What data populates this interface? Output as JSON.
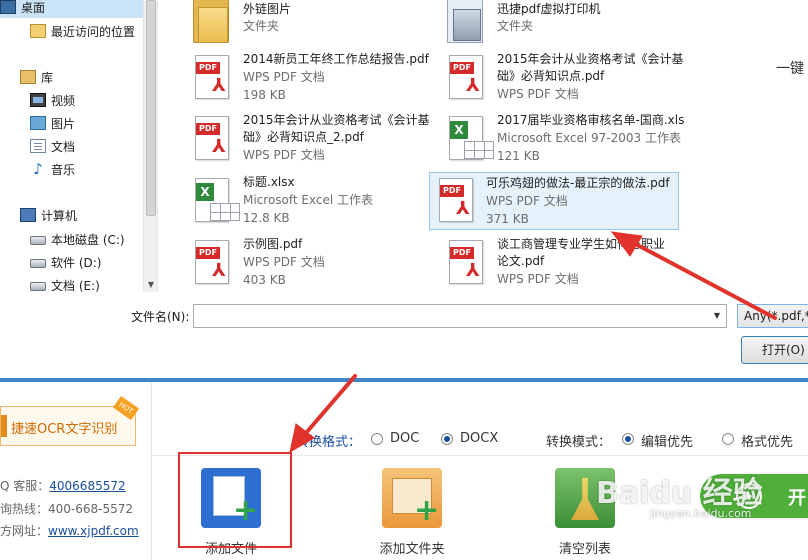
{
  "dialog": {
    "nav": {
      "items": [
        {
          "label": "桌面",
          "icon": "desktop-icon"
        },
        {
          "label": "最近访问的位置",
          "icon": "recent-places-icon"
        },
        {
          "label": "库",
          "icon": "library-icon"
        },
        {
          "label": "视频",
          "icon": "video-library-icon"
        },
        {
          "label": "图片",
          "icon": "picture-library-icon"
        },
        {
          "label": "文档",
          "icon": "document-library-icon"
        },
        {
          "label": "音乐",
          "icon": "music-library-icon"
        },
        {
          "label": "计算机",
          "icon": "computer-icon"
        },
        {
          "label": "本地磁盘 (C:)",
          "icon": "drive-icon"
        },
        {
          "label": "软件 (D:)",
          "icon": "drive-icon"
        },
        {
          "label": "文档 (E:)",
          "icon": "drive-icon"
        }
      ]
    },
    "files": [
      {
        "name": "外链图片",
        "type": "文件夹",
        "size": "",
        "icon": "folder-icon"
      },
      {
        "name": "迅捷pdf虚拟打印机",
        "type": "文件夹",
        "size": "",
        "icon": "folder-icon"
      },
      {
        "name": "2014新员工年终工作总结报告.pdf",
        "name2": "",
        "type": "WPS PDF 文档",
        "size": "198 KB",
        "icon": "pdf-file-icon"
      },
      {
        "name": "2015年会计从业资格考试《会计基",
        "name2": "础》必背知识点.pdf",
        "type": "WPS PDF 文档",
        "size": "",
        "icon": "pdf-file-icon"
      },
      {
        "name": "2015年会计从业资格考试《会计基",
        "name2": "础》必背知识点_2.pdf",
        "type": "WPS PDF 文档",
        "size": "",
        "icon": "pdf-file-icon"
      },
      {
        "name": "2017届毕业资格审核名单-国商.xls",
        "name2": "",
        "type": "Microsoft Excel 97-2003 工作表",
        "size": "121 KB",
        "icon": "excel-file-icon"
      },
      {
        "name": "标题.xlsx",
        "name2": "",
        "type": "Microsoft Excel 工作表",
        "size": "12.8 KB",
        "icon": "excel-file-icon"
      },
      {
        "name": "可乐鸡翅的做法-最正宗的做法.pdf",
        "name2": "",
        "type": "WPS PDF 文档",
        "size": "371 KB",
        "icon": "pdf-file-icon"
      },
      {
        "name": "示例图.pdf",
        "name2": "",
        "type": "WPS PDF 文档",
        "size": "403 KB",
        "icon": "pdf-file-icon"
      },
      {
        "name": "谈工商管理专业学生如何与职业",
        "name2": "论文.pdf",
        "type": "WPS PDF 文档",
        "size": "",
        "icon": "pdf-file-icon"
      }
    ],
    "filename_label": "文件名(N):",
    "filename_value": "",
    "filetype_value": "Any(*.pdf,*.",
    "open_label": "打开(O)"
  },
  "app": {
    "ocr_label": "捷速OCR文字识别",
    "ocr_badge": "HOT",
    "contacts": [
      {
        "prefix": "Q 客服：",
        "value": "4006685572",
        "link": true
      },
      {
        "prefix": "询热线：",
        "value": "400-668-5572",
        "link": false
      },
      {
        "prefix": "方网址：",
        "value": "www.xjpdf.com",
        "link": true
      }
    ],
    "format_label": "转换格式：",
    "format_options": [
      "DOC",
      "DOCX"
    ],
    "format_selected": "DOCX",
    "mode_label": "转换模式：",
    "mode_options": [
      "编辑优先",
      "格式优先"
    ],
    "mode_selected": "编辑优先",
    "actions": {
      "add_file": "添加文件",
      "add_folder": "添加文件夹",
      "clear_list": "清空列表"
    },
    "onekey_label": "一键",
    "start_label": "开"
  },
  "watermark": {
    "text": "Baidu 经验",
    "url": "jingyan.baidu.com"
  },
  "colors": {
    "accent": "#3e86c7",
    "annotation": "#e0332b",
    "start_green": "#4faf3a",
    "link": "#1a4fa0"
  }
}
